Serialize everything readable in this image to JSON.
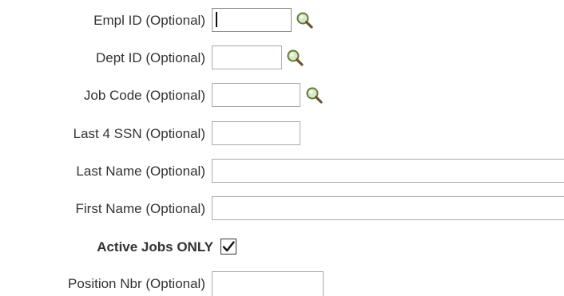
{
  "form": {
    "fields": {
      "empl_id": {
        "label": "Empl ID (Optional)",
        "value": ""
      },
      "dept_id": {
        "label": "Dept ID (Optional)",
        "value": ""
      },
      "job_code": {
        "label": "Job Code (Optional)",
        "value": ""
      },
      "last4_ssn": {
        "label": "Last 4 SSN (Optional)",
        "value": ""
      },
      "last_name": {
        "label": "Last Name (Optional)",
        "value": ""
      },
      "first_name": {
        "label": "First Name (Optional)",
        "value": ""
      },
      "active_jobs_only": {
        "label": "Active Jobs ONLY",
        "checked": true
      },
      "position_nbr": {
        "label": "Position Nbr (Optional)",
        "value": ""
      }
    },
    "icons": {
      "lookup": "magnifying-glass-icon",
      "check": "checkmark-icon"
    },
    "colors": {
      "text": "#333333",
      "input_border": "#a9a9a9",
      "lens_fill": "#dbe8c8",
      "lens_ring": "#5e7c33"
    }
  }
}
